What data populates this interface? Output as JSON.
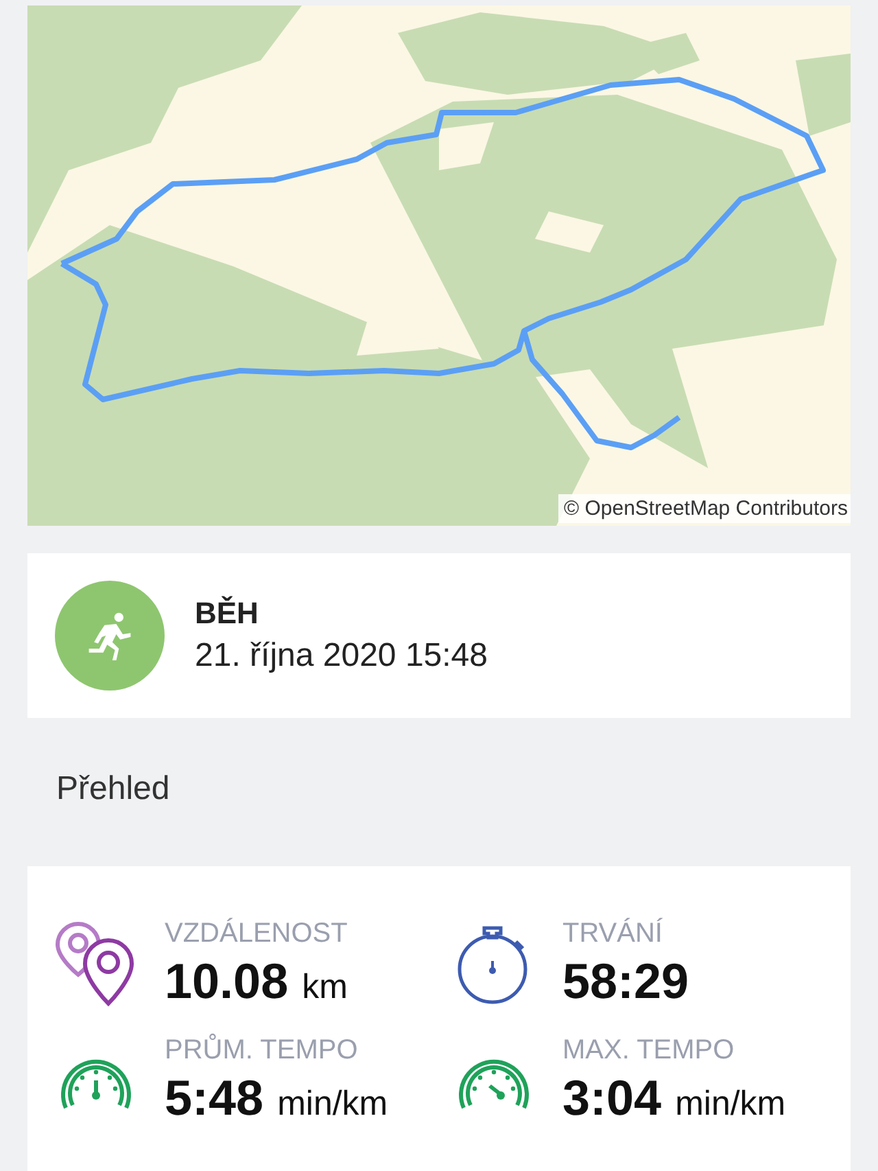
{
  "map": {
    "attribution": "© OpenStreetMap Contributors"
  },
  "activity": {
    "kind": "run",
    "title": "BĚH",
    "datetime": "21. října 2020 15:48"
  },
  "section_title": "Přehled",
  "stats": [
    {
      "kind": "distance",
      "label": "VZDÁLENOST",
      "value": "10.08",
      "unit": "km"
    },
    {
      "kind": "duration",
      "label": "TRVÁNÍ",
      "value": "58:29"
    },
    {
      "kind": "avg_pace",
      "label": "PRŮM. TEMPO",
      "value": "5:48",
      "unit": "min/km"
    },
    {
      "kind": "max_pace",
      "label": "MAX. TEMPO",
      "value": "3:04",
      "unit": "min/km"
    }
  ]
}
